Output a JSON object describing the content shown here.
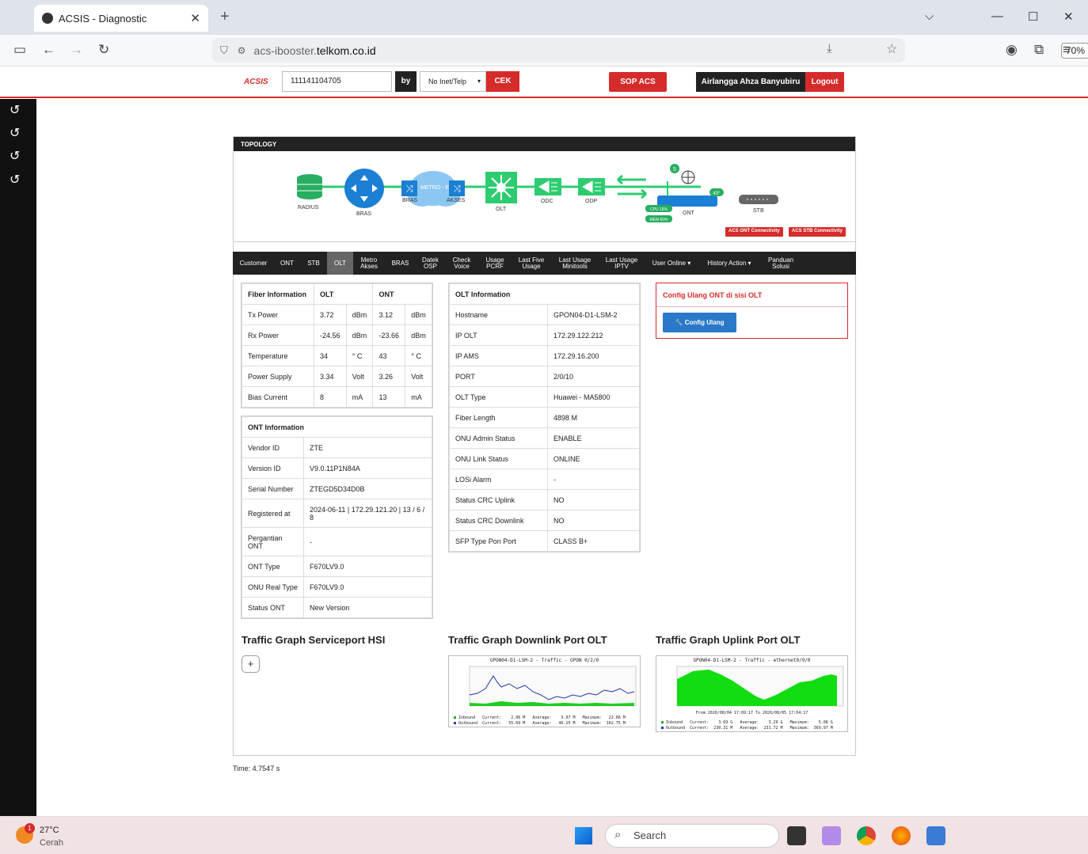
{
  "browser": {
    "tab_title": "ACSIS - Diagnostic",
    "url_prefix": "acs-ibooster.",
    "url_host": "telkom.co.id",
    "zoom": "70%"
  },
  "header": {
    "brand": "ACSIS",
    "search_value": "111141104705",
    "by_label": "by",
    "select_value": "No Inet/Telp",
    "cek_label": "CEK",
    "sop_label": "SOP ACS",
    "user_name": "Airlangga Ahza Banyubiru",
    "logout_label": "Logout"
  },
  "topology": {
    "title": "TOPOLOGY",
    "labels": {
      "radius": "RADIUS",
      "bras": "BRAS",
      "bras2": "BRAS",
      "metro": "METRO - E",
      "akses": "AKSES",
      "olt": "OLT",
      "odc": "ODC",
      "odp": "ODP",
      "ont": "ONT",
      "stb": "STB",
      "cpu": "CPU 16%",
      "mem": "MEM 60%",
      "temp": "43°",
      "wifi_count": "5"
    },
    "acs_ont_btn": "ACS ONT Connectivity",
    "acs_stb_btn": "ACS STB Connectivity"
  },
  "menu_tabs": [
    "Customer",
    "ONT",
    "STB",
    "OLT",
    "Metro Akses",
    "BRAS",
    "Datek OSP",
    "Check Voice",
    "Usage PCRF",
    "Last Five Usage",
    "Last Usage Minitools",
    "Last Usage IPTV",
    "User Online ▾",
    "History Action ▾",
    "Panduan Solusi"
  ],
  "fiber": {
    "headers": [
      "Fiber Information",
      "OLT",
      "ONT"
    ],
    "rows": [
      [
        "Tx Power",
        "3.72",
        "dBm",
        "3.12",
        "dBm"
      ],
      [
        "Rx Power",
        "-24.56",
        "dBm",
        "-23.66",
        "dBm"
      ],
      [
        "Temperature",
        "34",
        "° C",
        "43",
        "° C"
      ],
      [
        "Power Supply",
        "3.34",
        "Volt",
        "3.26",
        "Volt"
      ],
      [
        "Bias Current",
        "8",
        "mA",
        "13",
        "mA"
      ]
    ]
  },
  "ont_info": {
    "title": "ONT Information",
    "rows": [
      [
        "Vendor ID",
        "ZTE"
      ],
      [
        "Version ID",
        "V9.0.11P1N84A"
      ],
      [
        "Serial Number",
        "ZTEGD5D34D0B"
      ],
      [
        "Registered at",
        "2024-06-11 | 172.29.121.20 | 13 / 6 / 8"
      ],
      [
        "Pergantian ONT",
        "-"
      ],
      [
        "ONT Type",
        "F670LV9.0"
      ],
      [
        "ONU Real Type",
        "F670LV9.0"
      ],
      [
        "Status ONT",
        "New Version"
      ]
    ]
  },
  "olt_info": {
    "title": "OLT Information",
    "rows": [
      [
        "Hostname",
        "GPON04-D1-LSM-2"
      ],
      [
        "IP OLT",
        "172.29.122.212"
      ],
      [
        "IP AMS",
        "172.29.16.200"
      ],
      [
        "PORT",
        "2/0/10"
      ],
      [
        "OLT Type",
        "Huawei - MA5800"
      ],
      [
        "Fiber Length",
        "4898 M"
      ],
      [
        "ONU Admin Status",
        "ENABLE"
      ],
      [
        "ONU Link Status",
        "ONLINE"
      ],
      [
        "LOSi Alarm",
        "-"
      ],
      [
        "Status CRC Uplink",
        "NO"
      ],
      [
        "Status CRC Downlink",
        "NO"
      ],
      [
        "SFP Type Pon Port",
        "CLASS B+"
      ]
    ]
  },
  "config": {
    "title": "Config Ulang ONT di sisi OLT",
    "button": "Config Ulang"
  },
  "graphs": {
    "hsi_title": "Traffic Graph Serviceport HSI",
    "downlink_title": "Traffic Graph Downlink Port OLT",
    "uplink_title": "Traffic Graph Uplink Port OLT",
    "downlink_caption": "GPON04-D1-LSM-2 - Traffic - GPON 0/2/0",
    "uplink_caption": "GPON04-D1-LSM-2 - Traffic - ethernet0/9/0",
    "downlink_in": "Inbound   Current:    2.06 M   Average:    3.07 M   Maximum:   22.66 M",
    "downlink_out": "Outbound  Current:   55.69 M   Average:   46.25 M   Maximum:  102.75 M",
    "uplink_range": "From 2026/08/04 17:09:17 To 2026/08/05 17:04:17",
    "uplink_in": "Inbound   Current:    3.69 G   Average:    3.29 G   Maximum:    5.08 G",
    "uplink_out": "Outbound  Current:  230.31 M   Average:  231.72 M   Maximum:  369.97 M"
  },
  "time_text": "Time: 4.7547 s",
  "taskbar": {
    "temp": "27°C",
    "cond": "Cerah",
    "search": "Search",
    "badge": "1"
  }
}
